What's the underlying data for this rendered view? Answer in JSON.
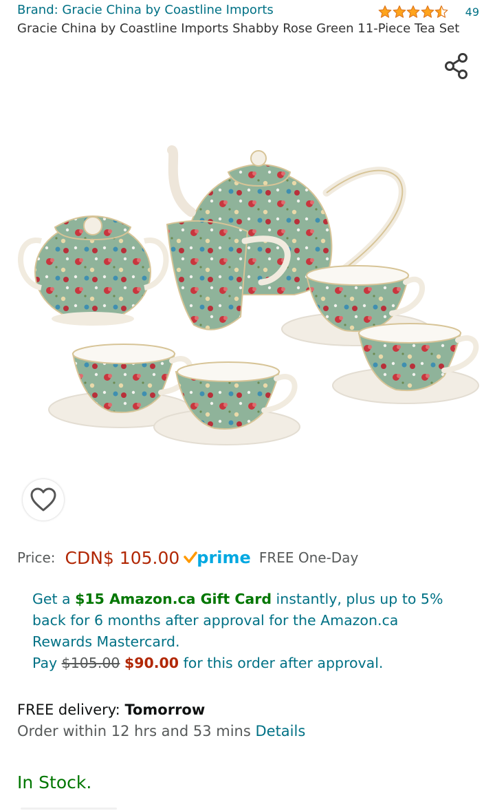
{
  "header": {
    "brand_label": "Brand: Gracie China by Coastline Imports",
    "rating_count": "49",
    "rating_stars": 4.5,
    "title": "Gracie China by Coastline Imports Shabby Rose Green 11-Piece Tea Set"
  },
  "icons": {
    "share": "share-icon",
    "wishlist": "heart-outline-icon",
    "star": "star-icon"
  },
  "price": {
    "label": "Price:",
    "value": "CDN$ 105.00",
    "prime_word": "prime",
    "shipping": "FREE One-Day"
  },
  "promo": {
    "get_a": "Get a ",
    "gift_card": "$15 Amazon.ca Gift Card",
    "rest": " instantly, plus up to 5% back for 6 months after approval for the Amazon.ca Rewards Mastercard.",
    "pay": "Pay ",
    "old_price": "$105.00",
    "new_price": "$90.00",
    "suffix": " for this order after approval."
  },
  "delivery": {
    "free_label": "FREE delivery: ",
    "date": "Tomorrow",
    "order_within": "Order within 12 hrs and 53 mins ",
    "details_link": "Details"
  },
  "stock": {
    "status": "In Stock."
  },
  "colors": {
    "link": "#007185",
    "price": "#b12704",
    "green": "#007600",
    "star": "#ffa41c",
    "prime": "#00a8e1"
  }
}
